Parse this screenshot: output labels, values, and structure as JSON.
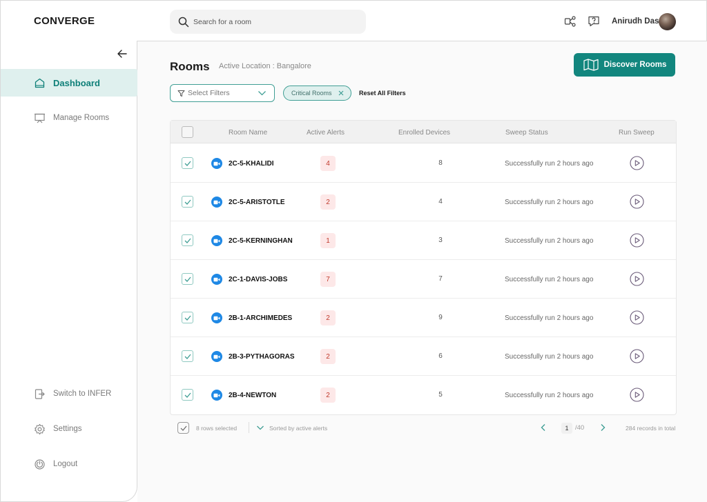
{
  "app": {
    "title": "CONVERGE"
  },
  "search": {
    "placeholder": "Search for a room"
  },
  "user": {
    "name": "Anirudh Das"
  },
  "sidebar": {
    "items": [
      {
        "label": "Dashboard",
        "icon": "home-icon",
        "active": true
      },
      {
        "label": "Manage Rooms",
        "icon": "projector-screen-icon",
        "active": false
      }
    ],
    "bottom_items": [
      {
        "label": "Switch to INFER",
        "icon": "switch-icon"
      },
      {
        "label": "Settings",
        "icon": "gear-icon"
      },
      {
        "label": "Logout",
        "icon": "power-icon"
      }
    ]
  },
  "main": {
    "title": "Rooms",
    "location": "Active Location : Bangalore",
    "discover_label": "Discover Rooms",
    "filter_placeholder": "Select Filters",
    "chip_label": "Critical Rooms",
    "reset_label": "Reset All Filters"
  },
  "table": {
    "columns": [
      "Room Name",
      "Active Alerts",
      "Enrolled Devices",
      "Sweep Status",
      "Run Sweep"
    ],
    "rows": [
      {
        "name": "2C-5-KHALIDI",
        "alerts": "4",
        "devices": "8",
        "status": "Successfully run 2 hours ago"
      },
      {
        "name": "2C-5-ARISTOTLE",
        "alerts": "2",
        "devices": "4",
        "status": "Successfully run 2 hours ago"
      },
      {
        "name": "2C-5-KERNINGHAN",
        "alerts": "1",
        "devices": "3",
        "status": "Successfully run 2 hours ago"
      },
      {
        "name": "2C-1-DAVIS-JOBS",
        "alerts": "7",
        "devices": "7",
        "status": "Successfully run 2 hours ago"
      },
      {
        "name": "2B-1-ARCHIMEDES",
        "alerts": "2",
        "devices": "9",
        "status": "Successfully run 2 hours ago"
      },
      {
        "name": "2B-3-PYTHAGORAS",
        "alerts": "2",
        "devices": "6",
        "status": "Successfully run 2 hours ago"
      },
      {
        "name": "2B-4-NEWTON",
        "alerts": "2",
        "devices": "5",
        "status": "Successfully run 2 hours ago"
      }
    ]
  },
  "footer": {
    "selected": "8 rows selected",
    "sorted": "Sorted  by active alerts",
    "page": "1",
    "page_total": "/40",
    "records": "284 records in total"
  },
  "colors": {
    "accent": "#12867e",
    "active_bg": "#dff0ee",
    "alert_bg": "#fde8e8",
    "camera": "#1e88e5"
  }
}
